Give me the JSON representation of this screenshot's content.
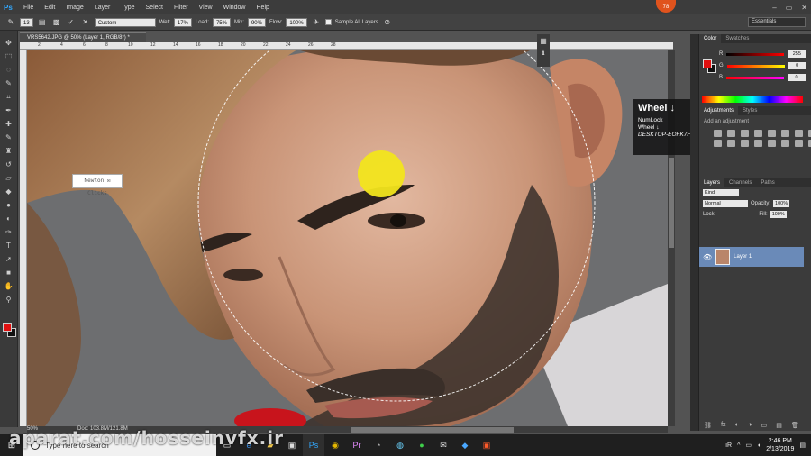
{
  "app": {
    "logo": "Ps",
    "menu": [
      "File",
      "Edit",
      "Image",
      "Layer",
      "Type",
      "Select",
      "Filter",
      "View",
      "Window",
      "Help"
    ],
    "window_controls": [
      "–",
      "▭",
      "✕"
    ],
    "badge": "78"
  },
  "options": {
    "brush_size": "13",
    "mode_value": "Custom",
    "wet_label": "Wet:",
    "wet_value": "17%",
    "load_label": "Load:",
    "load_value": "75%",
    "mix_label": "Mix:",
    "mix_value": "90%",
    "flow_label": "Flow:",
    "flow_value": "100%",
    "sample_label": "Sample All Layers",
    "workspace": "Essentials"
  },
  "document": {
    "tab_title": "VRS5642.JPG @ 50% (Layer 1, RGB/8*) *",
    "zoom": "50%",
    "doc_info": "Doc: 103.8M/121.8M",
    "ruler_ticks": [
      "2",
      "4",
      "6",
      "8",
      "10",
      "12",
      "14",
      "16",
      "18",
      "20",
      "22",
      "24",
      "26",
      "28"
    ],
    "embedded_label": "Newton ✉ Clicks"
  },
  "key_overlay": {
    "title": "Wheel ↓",
    "line1": "NumLock",
    "line2": "Wheel ↓",
    "host": "DESKTOP-EOFK7FJ"
  },
  "panels": {
    "color_tabs": [
      "Color",
      "Swatches"
    ],
    "r_label": "R",
    "r_value": "255",
    "g_label": "G",
    "g_value": "0",
    "b_label": "B",
    "b_value": "0",
    "adj_tabs": [
      "Adjustments",
      "Styles"
    ],
    "adj_hint": "Add an adjustment",
    "layer_tabs": [
      "Layers",
      "Channels",
      "Paths"
    ],
    "kind_label": "Kind",
    "blend_mode": "Normal",
    "opacity_label": "Opacity:",
    "opacity_value": "100%",
    "lock_label": "Lock:",
    "fill_label": "Fill:",
    "fill_value": "100%",
    "layer_name": "Layer 1",
    "footer_icons": [
      "⛓",
      "fx",
      "◐",
      "◑",
      "▭",
      "▤",
      "🗑"
    ]
  },
  "taskbar": {
    "search_placeholder": "Type here to search",
    "time": "2:46 PM",
    "date": "2/13/2019",
    "tray_glyphs": [
      "ıR",
      "^"
    ]
  },
  "watermark": "aparat.com/hosseinvfx.ir",
  "colors": {
    "foreground": "#e01010",
    "background": "#111111",
    "accent": "#31a8ff",
    "selected_layer": "#6a8ab8"
  }
}
